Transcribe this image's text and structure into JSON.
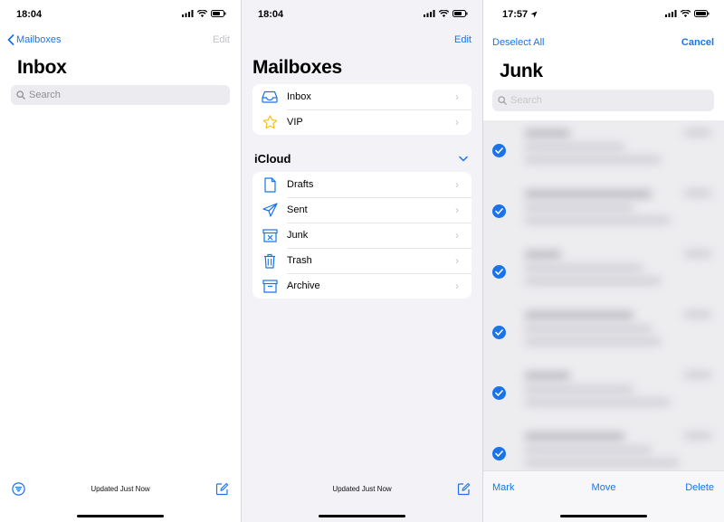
{
  "colors": {
    "accent": "#1a73e8",
    "vip_star": "#f0c419"
  },
  "inbox": {
    "time": "18:04",
    "back_label": "Mailboxes",
    "edit_label": "Edit",
    "title": "Inbox",
    "search_placeholder": "Search",
    "status": "Updated Just Now"
  },
  "mailboxes": {
    "time": "18:04",
    "edit_label": "Edit",
    "title": "Mailboxes",
    "top_items": [
      {
        "label": "Inbox",
        "icon": "inbox-tray-icon"
      },
      {
        "label": "VIP",
        "icon": "star-icon"
      }
    ],
    "account_name": "iCloud",
    "account_items": [
      {
        "label": "Drafts",
        "icon": "document-icon"
      },
      {
        "label": "Sent",
        "icon": "paper-plane-icon"
      },
      {
        "label": "Junk",
        "icon": "junk-bin-icon"
      },
      {
        "label": "Trash",
        "icon": "trash-icon"
      },
      {
        "label": "Archive",
        "icon": "archive-box-icon"
      }
    ],
    "status": "Updated Just Now"
  },
  "junk": {
    "time": "17:57",
    "deselect_label": "Deselect All",
    "cancel_label": "Cancel",
    "title": "Junk",
    "search_placeholder": "Search",
    "selected_rows": 6,
    "toolbar": {
      "mark": "Mark",
      "move": "Move",
      "delete": "Delete"
    }
  }
}
